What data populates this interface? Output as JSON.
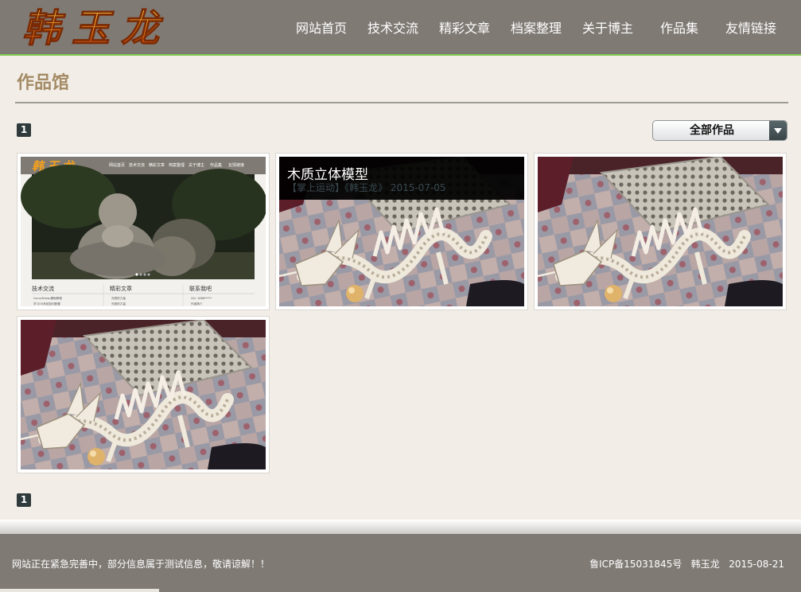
{
  "header": {
    "logo_text": "韩玉龙",
    "nav": [
      {
        "label": "网站首页",
        "icon": "none"
      },
      {
        "label": "技术交流",
        "icon": "none"
      },
      {
        "label": "精彩文章",
        "icon": "none"
      },
      {
        "label": "档案整理",
        "icon": "none"
      },
      {
        "label": "关于博主",
        "icon": "none"
      },
      {
        "label": "作品集",
        "icon": "none"
      },
      {
        "label": "友情链接",
        "icon": "none"
      }
    ]
  },
  "page": {
    "title": "作品馆"
  },
  "pagination": {
    "top_page": "1",
    "bottom_page": "1"
  },
  "category_select": {
    "selected": "全部作品",
    "icon": "dropdown-arrow-icon"
  },
  "gallery": {
    "items": [
      {
        "kind": "website-screenshot",
        "mini_nav": [
          "网站首页",
          "技术交流",
          "精彩文章",
          "档案整理",
          "关于博主",
          "作品集",
          "友情链接"
        ],
        "mini_logo": "韩玉龙",
        "mini_columns": [
          "技术交流",
          "精彩文章",
          "联系我吧"
        ],
        "mini_lines": [
          [
            "Linux/Nmap基础教程",
            "学习OS系统如何配置"
          ],
          [
            "光阴的力量",
            "光阴的力量"
          ],
          [
            "QQ: 1668*****",
            "作者简介"
          ]
        ]
      },
      {
        "kind": "photo-dragon",
        "caption_title": "木质立体模型",
        "caption_meta": "【掌上运动】《韩玉龙》 2015-07-05"
      },
      {
        "kind": "photo-dragon"
      },
      {
        "kind": "photo-dragon"
      }
    ]
  },
  "footer": {
    "notice": "网站正在紧急完善中，部分信息属于测试信息，敬请谅解！！",
    "icp": "鲁ICP备15031845号",
    "author": "韩玉龙",
    "date": "2015-08-21"
  },
  "colors": {
    "header_bg": "#7f7a74",
    "accent_green": "#7fc84e",
    "page_bg": "#f2eee7",
    "title_color": "#a48a65"
  }
}
